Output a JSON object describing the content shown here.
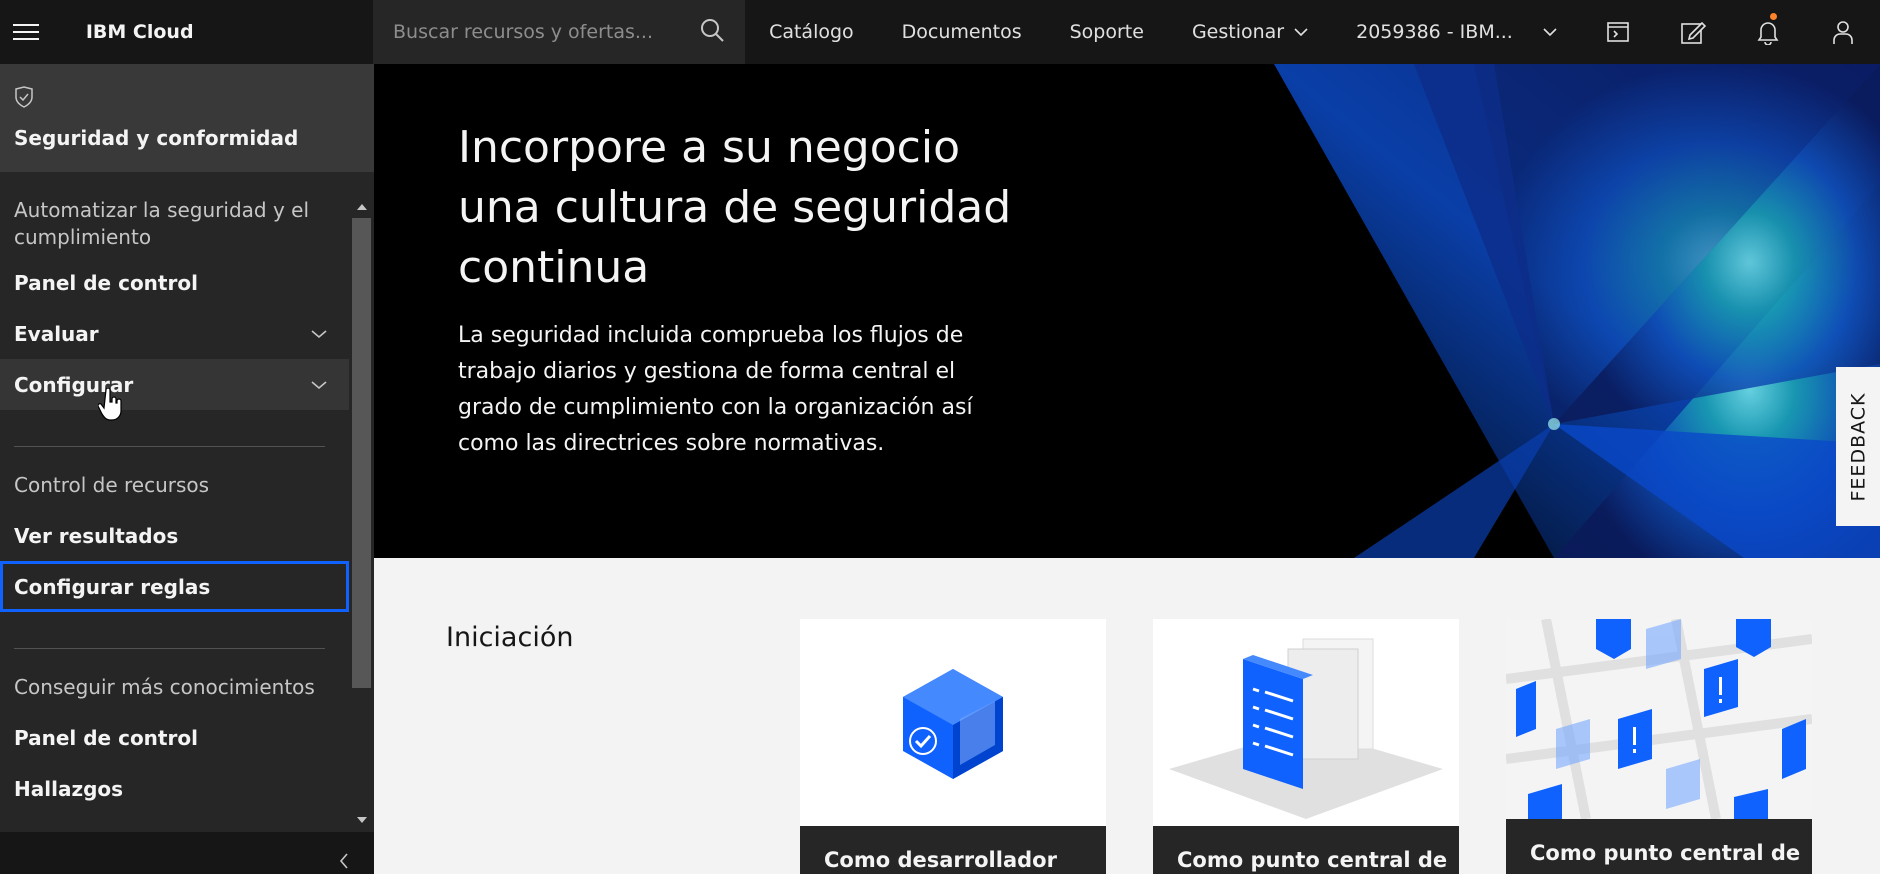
{
  "header": {
    "brand": "IBM Cloud",
    "search_placeholder": "Buscar recursos y ofertas...",
    "nav": {
      "catalog": "Catálogo",
      "docs": "Documentos",
      "support": "Soporte",
      "manage": "Gestionar",
      "account": "2059386 - IBM..."
    },
    "icons": [
      "menu-icon",
      "search-icon",
      "cost-estimator-icon",
      "edit-icon",
      "notification-icon",
      "user-icon"
    ],
    "notification_color": "#ff832b"
  },
  "sidebar": {
    "title": "Seguridad y conformidad",
    "groups": [
      {
        "heading": "Automatizar la seguridad y el cumplimiento",
        "items": [
          {
            "label": "Panel de control"
          },
          {
            "label": "Evaluar"
          },
          {
            "label": "Configurar"
          }
        ]
      },
      {
        "heading": "Control de recursos",
        "items": [
          {
            "label": "Ver resultados"
          },
          {
            "label": "Configurar reglas"
          }
        ]
      },
      {
        "heading": "Conseguir más conocimientos",
        "items": [
          {
            "label": "Panel de control"
          },
          {
            "label": "Hallazgos"
          }
        ]
      }
    ],
    "selected_color": "#0f62fe"
  },
  "hero": {
    "title": "Incorpore a su negocio una cultura de seguridad continua",
    "text": "La seguridad incluida comprueba los flujos de trabajo diarios y gestiona de forma central el grado de cumplimiento con la organización así como las directrices sobre normativas."
  },
  "feedback": "FEEDBACK",
  "getting_started": {
    "title": "Iniciación",
    "cards": [
      {
        "label": "Como desarrollador"
      },
      {
        "label": "Como punto central de"
      },
      {
        "label": "Como punto central de"
      }
    ]
  }
}
